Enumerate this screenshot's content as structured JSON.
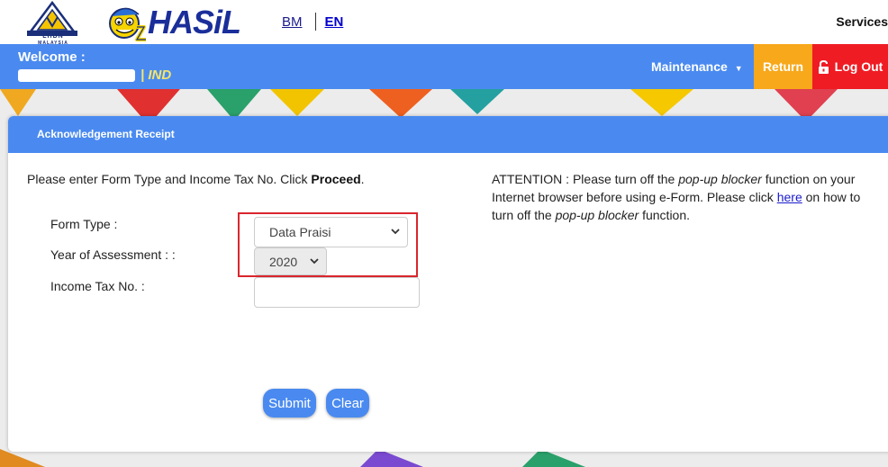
{
  "header": {
    "lhdn_logo_text": "LHDN",
    "lhdn_country": "MALAYSIA",
    "brand_text": "HASiL",
    "lang_bm": "BM",
    "lang_en": "EN",
    "services": "Services"
  },
  "navbar": {
    "welcome": "Welcome :",
    "user_suffix": "| IND",
    "maintenance": "Maintenance",
    "return": "Return",
    "logout": "Log Out"
  },
  "card": {
    "title": "Acknowledgement Receipt",
    "instruction_prefix": "Please enter Form Type and Income Tax No. Click ",
    "instruction_bold": "Proceed",
    "instruction_suffix": ".",
    "attention_1": "ATTENTION : Please turn off the ",
    "attention_em1": "pop-up blocker",
    "attention_2": " function on your Internet browser before using e-Form. Please click ",
    "attention_link": "here",
    "attention_3": " on how to turn off the ",
    "attention_em2": "pop-up blocker",
    "attention_4": " function."
  },
  "form": {
    "form_type_label": "Form Type :",
    "form_type_value": "Data Praisi",
    "year_label": "Year of Assessment : :",
    "year_value": "2020",
    "tax_no_label": "Income Tax No. :",
    "tax_no_value": "",
    "submit": "Submit",
    "clear": "Clear"
  },
  "colors": {
    "nav_blue": "#4a8af0",
    "return_orange": "#f7a81b",
    "logout_red": "#ef1c24",
    "highlight_red": "#d9262e"
  },
  "icons": [
    "lhdn-logo",
    "ezhasil-mascot-icon",
    "chevron-down-icon",
    "unlock-icon"
  ]
}
